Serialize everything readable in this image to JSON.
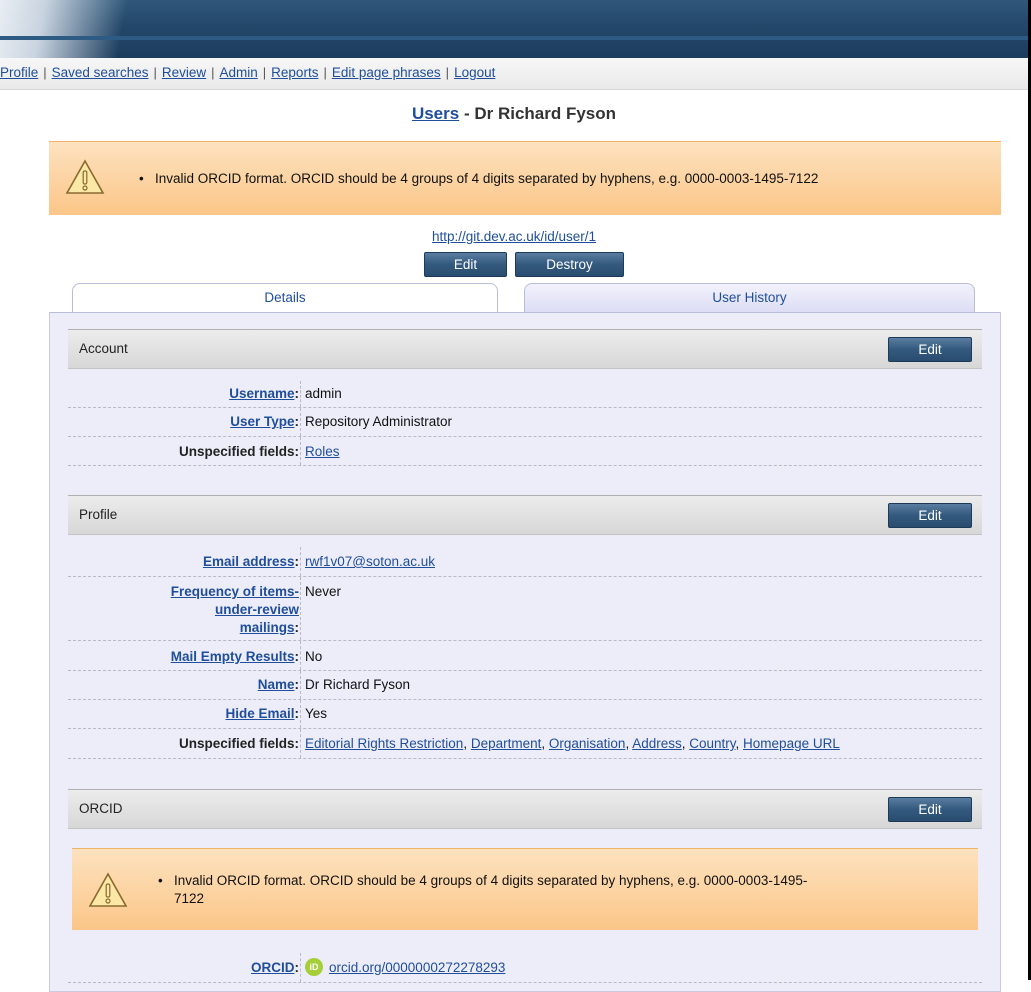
{
  "menu": [
    "Profile",
    "Saved searches",
    "Review",
    "Admin",
    "Reports",
    "Edit page phrases",
    "Logout"
  ],
  "title": {
    "link": "Users",
    "rest": " - Dr Richard Fyson"
  },
  "top_warning": "Invalid ORCID format. ORCID should be 4 groups of 4 digits separated by hyphens, e.g. 0000-0003-1495-7122",
  "uri": "http://git.dev.ac.uk/id/user/1",
  "buttons": {
    "edit": "Edit",
    "destroy": "Destroy"
  },
  "tabs": [
    "Details",
    "User History"
  ],
  "account": {
    "heading": "Account",
    "edit": "Edit",
    "username_label": "Username",
    "username_value": "admin",
    "usertype_label": "User Type",
    "usertype_value": "Repository Administrator",
    "unspecified_label": "Unspecified fields:",
    "unspecified_values": [
      "Roles"
    ]
  },
  "profile": {
    "heading": "Profile",
    "edit": "Edit",
    "email_label": "Email address",
    "email_value": "rwf1v07@soton.ac.uk",
    "freq_label_1": "Frequency of items-",
    "freq_label_2": "under-review",
    "freq_label_3": "mailings",
    "freq_value": "Never",
    "mailempty_label": "Mail Empty Results",
    "mailempty_value": "No",
    "name_label": "Name",
    "name_value": "Dr Richard Fyson",
    "hideemail_label": "Hide Email",
    "hideemail_value": "Yes",
    "unspecified_label": "Unspecified fields:",
    "unspecified_values": [
      "Editorial Rights Restriction",
      "Department",
      "Organisation",
      "Address",
      "Country",
      "Homepage URL"
    ]
  },
  "orcid": {
    "heading": "ORCID",
    "edit": "Edit",
    "warning_line1": "Invalid ORCID format. ORCID should be 4 groups of 4 digits separated by hyphens, e.g. 0000-0003-1495-",
    "warning_line2": "7122",
    "label": "ORCID",
    "icon_text": "iD",
    "value": "orcid.org/0000000272278293"
  }
}
